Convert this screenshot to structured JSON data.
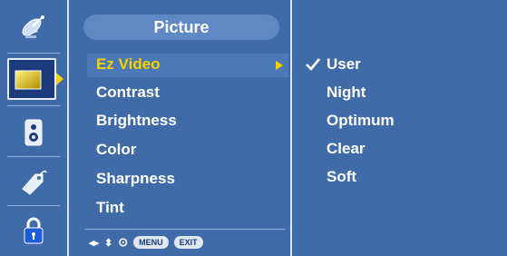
{
  "menu": {
    "title": "Picture",
    "items": [
      "Ez Video",
      "Contrast",
      "Brightness",
      "Color",
      "Sharpness",
      "Tint"
    ],
    "selected_index": 0
  },
  "submenu": {
    "items": [
      "User",
      "Night",
      "Optimum",
      "Clear",
      "Soft"
    ],
    "checked_index": 0
  },
  "footer": {
    "lr_symbol": "◂▸",
    "ud_symbol": "⬍",
    "ok_symbol": "⊙",
    "menu_label": "MENU",
    "exit_label": "EXIT"
  },
  "sidebar": {
    "icons": [
      "satellite-icon",
      "picture-icon",
      "speaker-icon",
      "tag-icon",
      "lock-icon"
    ],
    "selected_index": 1
  },
  "colors": {
    "background": "#3f6ba8",
    "highlight_text": "#f5d100",
    "text": "#ffffff"
  }
}
